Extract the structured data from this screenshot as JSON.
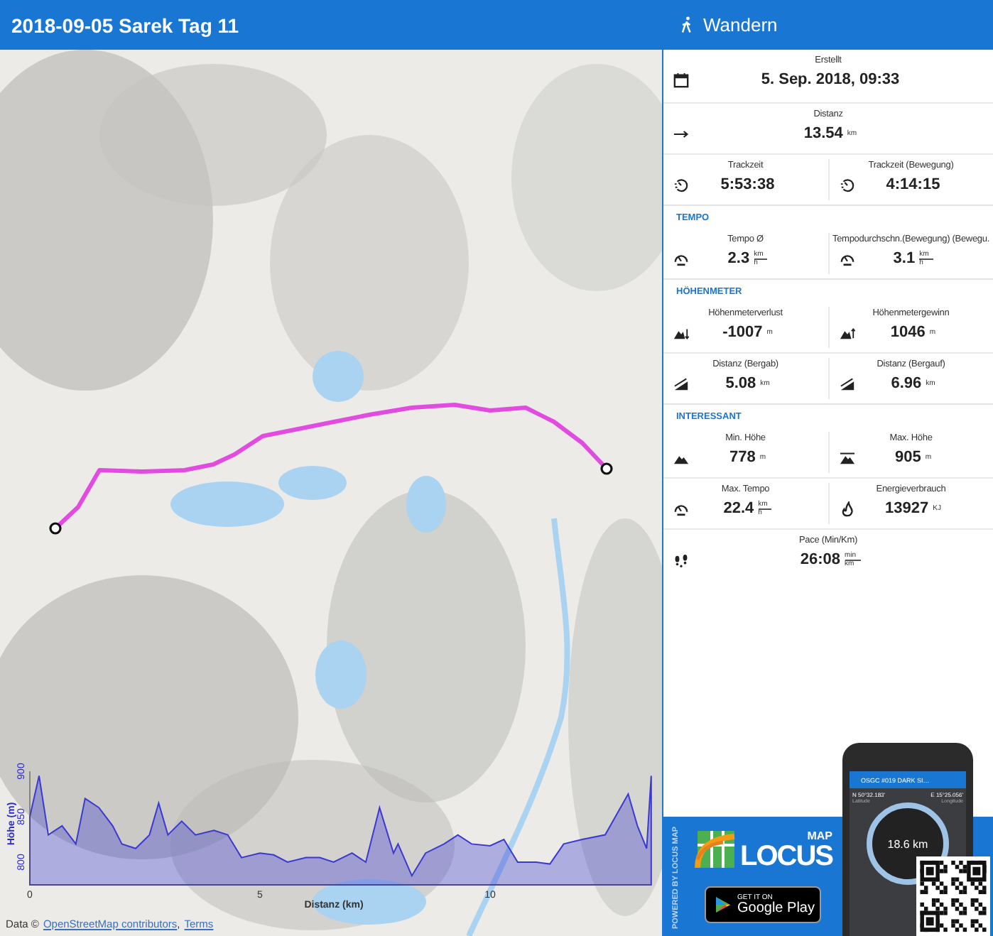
{
  "header": {
    "title": "2018-09-05 Sarek Tag 11",
    "activity": "Wandern"
  },
  "map": {
    "attribution_prefix": "Data ©",
    "attribution_link": "OpenStreetMap contributors",
    "attribution_separator": ",",
    "terms_link": "Terms",
    "chart_data": {
      "type": "area",
      "xlabel": "Distanz (km)",
      "ylabel": "Höhe (m)",
      "xlim": [
        0,
        13.5
      ],
      "ylim": [
        775,
        900
      ],
      "xticks": [
        0,
        5,
        10
      ],
      "yticks": [
        800,
        850,
        900
      ],
      "x": [
        0,
        0.2,
        0.4,
        0.7,
        1,
        1.2,
        1.5,
        1.8,
        2,
        2.3,
        2.6,
        2.8,
        3,
        3.3,
        3.6,
        4,
        4.3,
        4.6,
        5,
        5.3,
        5.6,
        6,
        6.3,
        6.6,
        7,
        7.3,
        7.6,
        7.9,
        8,
        8.3,
        8.6,
        9,
        9.3,
        9.6,
        10,
        10.3,
        10.6,
        11,
        11.3,
        11.6,
        12,
        12.5,
        13,
        13.2,
        13.4,
        13.5
      ],
      "series": [
        {
          "color": "#3a3ad0",
          "values": [
            850,
            895,
            830,
            840,
            820,
            870,
            860,
            840,
            820,
            815,
            830,
            865,
            830,
            845,
            830,
            835,
            830,
            805,
            810,
            808,
            800,
            805,
            805,
            800,
            810,
            800,
            860,
            810,
            820,
            785,
            810,
            820,
            830,
            820,
            818,
            825,
            800,
            800,
            798,
            820,
            825,
            830,
            875,
            840,
            815,
            895
          ]
        }
      ]
    }
  },
  "stats": [
    {
      "kind": "row",
      "cells": [
        {
          "kind": "date",
          "label": "Erstellt",
          "value": "5. Sep. 2018, 09:33"
        }
      ]
    },
    {
      "kind": "row",
      "cells": [
        {
          "kind": "distance",
          "label": "Distanz",
          "value": "13.54",
          "unit": "km"
        }
      ]
    },
    {
      "kind": "row",
      "cells": [
        {
          "kind": "time",
          "label": "Trackzeit",
          "value": "5:53:38"
        },
        {
          "kind": "time",
          "label": "Trackzeit (Bewegung)",
          "value": "4:14:15"
        }
      ]
    },
    {
      "kind": "section",
      "title": "TEMPO"
    },
    {
      "kind": "row",
      "cells": [
        {
          "kind": "speed",
          "label": "Tempo Ø",
          "value": "2.3",
          "unit": "km",
          "unit_below": "h"
        },
        {
          "kind": "speed",
          "label": "Tempodurchschn.(Bewegung) (Bewegu.",
          "value": "3.1",
          "unit": "km",
          "unit_below": "h"
        }
      ]
    },
    {
      "kind": "section",
      "title": "HÖHENMETER"
    },
    {
      "kind": "row",
      "cells": [
        {
          "kind": "descent",
          "label": "Höhenmeterverlust",
          "value": "-1007",
          "unit": "m"
        },
        {
          "kind": "ascent",
          "label": "Höhenmetergewinn",
          "value": "1046",
          "unit": "m"
        }
      ]
    },
    {
      "kind": "row",
      "cells": [
        {
          "kind": "slope",
          "label": "Distanz (Bergab)",
          "value": "5.08",
          "unit": "km"
        },
        {
          "kind": "slope",
          "label": "Distanz (Bergauf)",
          "value": "6.96",
          "unit": "km"
        }
      ]
    },
    {
      "kind": "section",
      "title": "INTERESSANT"
    },
    {
      "kind": "row",
      "cells": [
        {
          "kind": "min-altitude",
          "label": "Min. Höhe",
          "value": "778",
          "unit": "m"
        },
        {
          "kind": "max-altitude",
          "label": "Max. Höhe",
          "value": "905",
          "unit": "m"
        }
      ]
    },
    {
      "kind": "row",
      "cells": [
        {
          "kind": "speed",
          "label": "Max. Tempo",
          "value": "22.4",
          "unit": "km",
          "unit_below": "h"
        },
        {
          "kind": "energy",
          "label": "Energieverbrauch",
          "value": "13927",
          "unit": "KJ"
        }
      ]
    },
    {
      "kind": "row",
      "cells": [
        {
          "kind": "pace",
          "label": "Pace (Min/Km)",
          "value": "26:08",
          "unit": "min",
          "unit_below": "km"
        }
      ]
    }
  ],
  "promo": {
    "powered": "POWERED BY LOCUS MAP",
    "logo_small": "MAP",
    "logo": "LOCUS",
    "badge_top": "GET IT ON",
    "badge_bottom": "Google Play",
    "phone": {
      "title": "OSGC #019 DARK SI…",
      "lat": "N 50°32.183'",
      "lon": "E 15°25.056'",
      "lat_label": "Latitude",
      "lon_label": "Longitude",
      "distance": "18.6 km"
    }
  }
}
